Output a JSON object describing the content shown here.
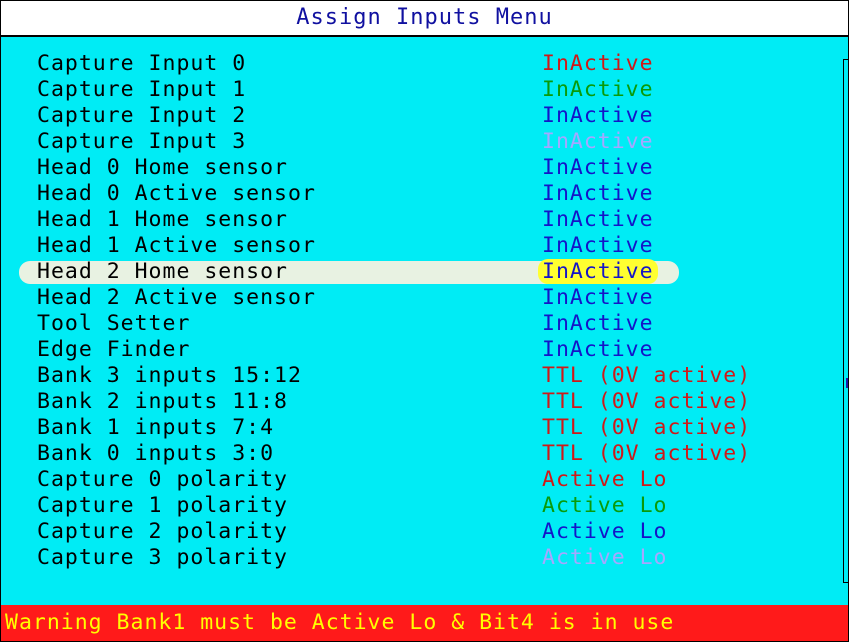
{
  "title": "Assign Inputs Menu",
  "colors": {
    "background": "#00ecf5",
    "red": "#d01818",
    "green": "#0a9a0a",
    "blue": "#1414c8",
    "lavender": "#a6a6ff",
    "highlight": "#ffff30",
    "statusbar": "#ff1a1a",
    "status_text": "#ffff00"
  },
  "rows": [
    {
      "label": "Capture Input 0",
      "value": "InActive",
      "color": "#d01818"
    },
    {
      "label": "Capture Input 1",
      "value": "InActive",
      "color": "#0a9a0a"
    },
    {
      "label": "Capture Input 2",
      "value": "InActive",
      "color": "#1414c8"
    },
    {
      "label": "Capture Input 3",
      "value": "InActive",
      "color": "#a6a6ff"
    },
    {
      "label": "Head 0 Home sensor",
      "value": "InActive",
      "color": "#1414c8"
    },
    {
      "label": "Head 0 Active sensor",
      "value": "InActive",
      "color": "#1414c8"
    },
    {
      "label": "Head 1 Home sensor",
      "value": "InActive",
      "color": "#1414c8"
    },
    {
      "label": "Head 1 Active sensor",
      "value": "InActive",
      "color": "#1414c8"
    },
    {
      "label": "Head 2 Home sensor",
      "value": "InActive",
      "color": "#1414c8",
      "selected": true
    },
    {
      "label": "Head 2 Active sensor",
      "value": "InActive",
      "color": "#1414c8"
    },
    {
      "label": "Tool Setter",
      "value": "InActive",
      "color": "#1414c8"
    },
    {
      "label": "Edge Finder",
      "value": "InActive",
      "color": "#1414c8"
    },
    {
      "label": "Bank 3 inputs 15:12",
      "value": "TTL (0V active)",
      "color": "#d01818"
    },
    {
      "label": "Bank 2 inputs 11:8",
      "value": "TTL (0V active)",
      "color": "#d01818"
    },
    {
      "label": "Bank 1 inputs 7:4",
      "value": "TTL (0V active)",
      "color": "#d01818"
    },
    {
      "label": "Bank 0 inputs 3:0",
      "value": "TTL (0V active)",
      "color": "#d01818"
    },
    {
      "label": "Capture 0 polarity",
      "value": "Active Lo",
      "color": "#d01818"
    },
    {
      "label": "Capture 1 polarity",
      "value": "Active Lo",
      "color": "#0a9a0a"
    },
    {
      "label": "Capture 2 polarity",
      "value": "Active Lo",
      "color": "#1414c8"
    },
    {
      "label": "Capture 3 polarity",
      "value": "Active Lo",
      "color": "#a6a6ff"
    }
  ],
  "status": "Warning Bank1 must be Active Lo & Bit4 is in use"
}
